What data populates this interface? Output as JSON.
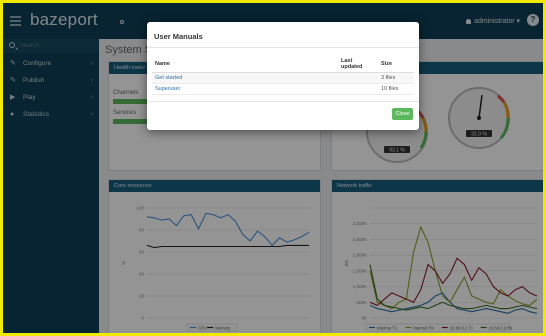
{
  "app": {
    "brand": "bazeport"
  },
  "topbar": {
    "user": "administrator ▾",
    "help": "?"
  },
  "sidebar": {
    "search_placeholder": "Search",
    "items": [
      {
        "label": "Configure",
        "icon": "wrench-icon",
        "glyph": "✎",
        "arrow": "›"
      },
      {
        "label": "Publish",
        "icon": "pencil-icon",
        "glyph": "✎",
        "arrow": "›"
      },
      {
        "label": "Play",
        "icon": "play-icon",
        "glyph": "▶",
        "arrow": "›"
      },
      {
        "label": "Statistics",
        "icon": "chart-icon",
        "glyph": "●",
        "arrow": "›"
      }
    ]
  },
  "main": {
    "title": "System Sta",
    "health": {
      "title": "Health overv",
      "channels": "Channels",
      "services": "Services"
    },
    "gauges": [
      {
        "readout": "93.1 %"
      },
      {
        "readout": "31.0 %"
      }
    ],
    "core": {
      "title": "Core resources"
    },
    "net": {
      "title": "Network traffic"
    }
  },
  "modal": {
    "title": "User Manuals",
    "columns": {
      "name": "Name",
      "updated": "Last updated",
      "size": "Size"
    },
    "rows": [
      {
        "name": "Get started",
        "updated": "",
        "size": "3 files"
      },
      {
        "name": "Superuser",
        "updated": "",
        "size": "10 files"
      }
    ],
    "close": "Close"
  },
  "colors": {
    "brand": "#0f3d55",
    "panel_head": "#17607f",
    "ok": "#5cb85c",
    "link": "#2a6fa8"
  },
  "chart_data": [
    {
      "type": "line",
      "title": "Core resources",
      "ylabel": "%",
      "ylim": [
        0,
        100
      ],
      "y_ticks": [
        0,
        20,
        40,
        60,
        80,
        100
      ],
      "legend_position": "bottom",
      "series": [
        {
          "name": "CPU",
          "color": "#4a90d9",
          "values": [
            92,
            91,
            89,
            90,
            84,
            93,
            94,
            81,
            95,
            94,
            91,
            94,
            88,
            76,
            70,
            79,
            74,
            66,
            73,
            69,
            71,
            74,
            78
          ]
        },
        {
          "name": "Memory",
          "color": "#222222",
          "values": [
            66,
            64,
            65,
            65,
            65,
            65,
            65,
            65,
            65,
            65,
            65,
            65,
            65,
            65,
            65,
            65,
            65,
            65,
            65,
            66,
            66,
            66,
            66
          ]
        }
      ]
    },
    {
      "type": "line",
      "title": "Network traffic",
      "ylabel": "B/s",
      "ylim": [
        0,
        3500
      ],
      "y_ticks": [
        0,
        500,
        1000,
        1500,
        2000,
        2500,
        3000,
        3500
      ],
      "y_tick_labels": [
        "0K",
        "500K",
        "1,000K",
        "1,500K",
        "2,000K",
        "2,500K",
        "3,000K",
        ""
      ],
      "legend_position": "bottom",
      "series": [
        {
          "name": "Internet Tx",
          "color": "#2a6fa8",
          "values": [
            400,
            300,
            250,
            200,
            250,
            300,
            350,
            400,
            500,
            700,
            800,
            500,
            300,
            250,
            200,
            250,
            300,
            250,
            200,
            150,
            250,
            300,
            200,
            150
          ]
        },
        {
          "name": "Internet Rx",
          "color": "#8aa02a",
          "values": [
            1500,
            500,
            400,
            300,
            500,
            600,
            2100,
            2900,
            2400,
            1500,
            700,
            500,
            900,
            1300,
            700,
            600,
            500,
            450,
            900,
            700,
            550,
            450,
            400,
            600
          ]
        },
        {
          "name": "10.60.0.2 Tx",
          "color": "#8b1a2a",
          "values": [
            500,
            400,
            600,
            800,
            700,
            600,
            500,
            900,
            1700,
            1500,
            1100,
            1400,
            1900,
            1700,
            1200,
            1600,
            1400,
            1000,
            800,
            700,
            900,
            1000,
            800,
            700
          ]
        },
        {
          "name": "10.60.0.2 Rx",
          "color": "#3b6a1f",
          "values": [
            1700,
            600,
            400,
            350,
            300,
            250,
            300,
            350,
            300,
            400,
            500,
            400,
            350,
            300,
            300,
            350,
            400,
            350,
            300,
            300,
            350,
            400,
            350,
            300
          ]
        }
      ]
    }
  ]
}
